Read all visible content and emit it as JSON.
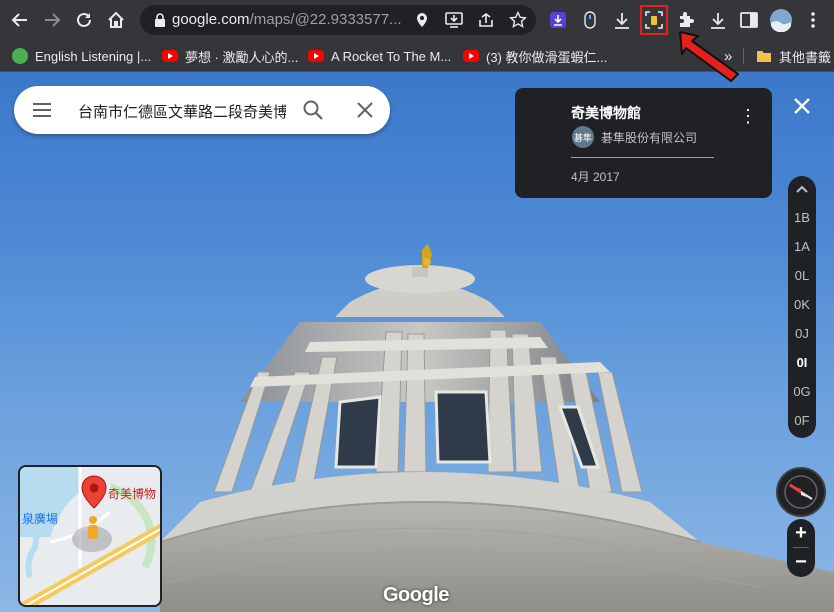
{
  "browser": {
    "url_host": "google.com",
    "url_path": "/maps/@22.9333577...",
    "bookmarks": [
      {
        "label": "English Listening |..."
      },
      {
        "label": "夢想 · 激勵人心的..."
      },
      {
        "label": "A Rocket To The M..."
      },
      {
        "label": "(3) 教你做滑蛋蝦仁..."
      }
    ],
    "bookmarks_overflow": "»",
    "other_bookmarks": "其他書籤"
  },
  "maps": {
    "search_value": "台南市仁德區文華路二段奇美博物館",
    "info_card": {
      "title": "奇美博物館",
      "avatar_text": "碁隼",
      "author": "碁隼股份有限公司",
      "date": "4月 2017"
    },
    "floors": [
      "1B",
      "1A",
      "0L",
      "0K",
      "0J",
      "0I",
      "0G",
      "0F"
    ],
    "active_floor": "0I",
    "zoom_in": "+",
    "zoom_out": "−",
    "minimap": {
      "place_label": "奇美博物",
      "area_label": "泉廣場"
    },
    "logo": "Google"
  },
  "colors": {
    "toolbar": "#35363a",
    "highlight": "#e8201a",
    "sky": "#4d89d4",
    "pin": "#ea4335"
  }
}
